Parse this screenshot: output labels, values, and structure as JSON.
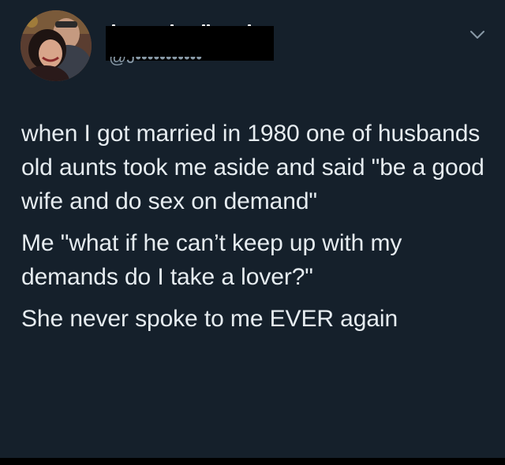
{
  "tweet": {
    "handle": "@J•••••••••••",
    "menu_icon": "chevron-down-icon",
    "paragraphs": [
      "when I got married in 1980 one of husbands old aunts took me aside and said  \"be a good wife and do sex on demand\"",
      "Me \"what if he can’t keep up with my demands do I take a lover?\"",
      "She never spoke to me EVER again"
    ]
  },
  "colors": {
    "background": "#15202b",
    "text": "#e6ecf0",
    "secondary_text": "#8899a6",
    "redaction": "#000000"
  }
}
